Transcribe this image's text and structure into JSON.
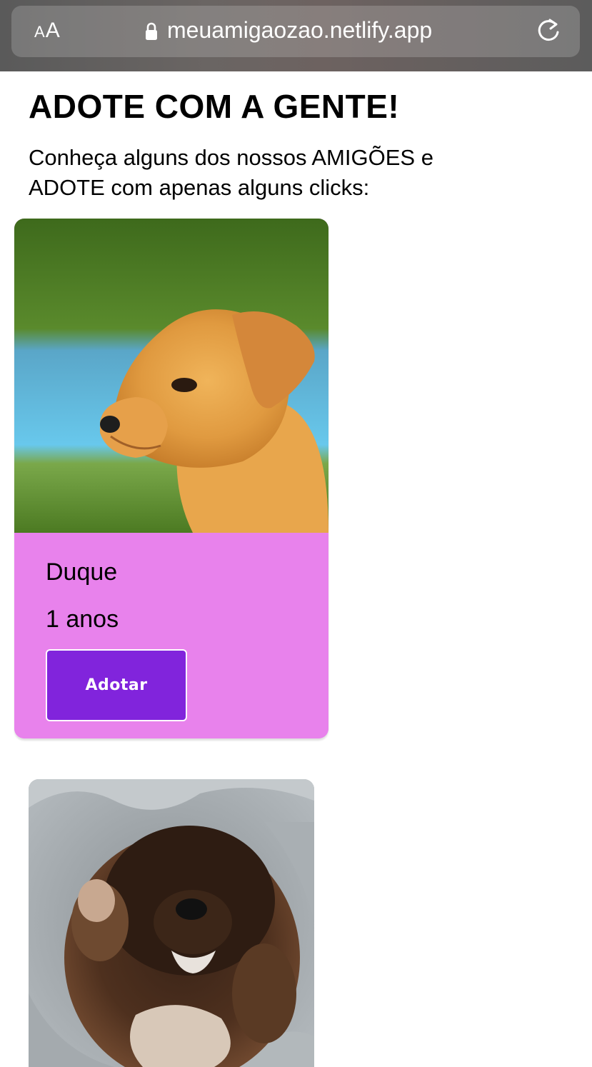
{
  "browser": {
    "text_size_small": "A",
    "text_size_big": "A",
    "url": "meuamigaozao.netlify.app",
    "icons": [
      "text-size-icon",
      "lock-icon",
      "reload-icon"
    ]
  },
  "page": {
    "title": "ADOTE COM A GENTE!",
    "subtitle": "Conheça alguns dos nossos AMIGÕES e ADOTE com apenas alguns clicks:"
  },
  "pets": [
    {
      "name": "Duque",
      "age": "1 anos",
      "button_label": "Adotar",
      "photo": "orange-puppy-photo"
    },
    {
      "photo": "sleeping-brown-puppy-photo"
    }
  ],
  "colors": {
    "card_background": "#e882ec",
    "button_background": "#8124dc",
    "button_border": "#ffffff"
  }
}
